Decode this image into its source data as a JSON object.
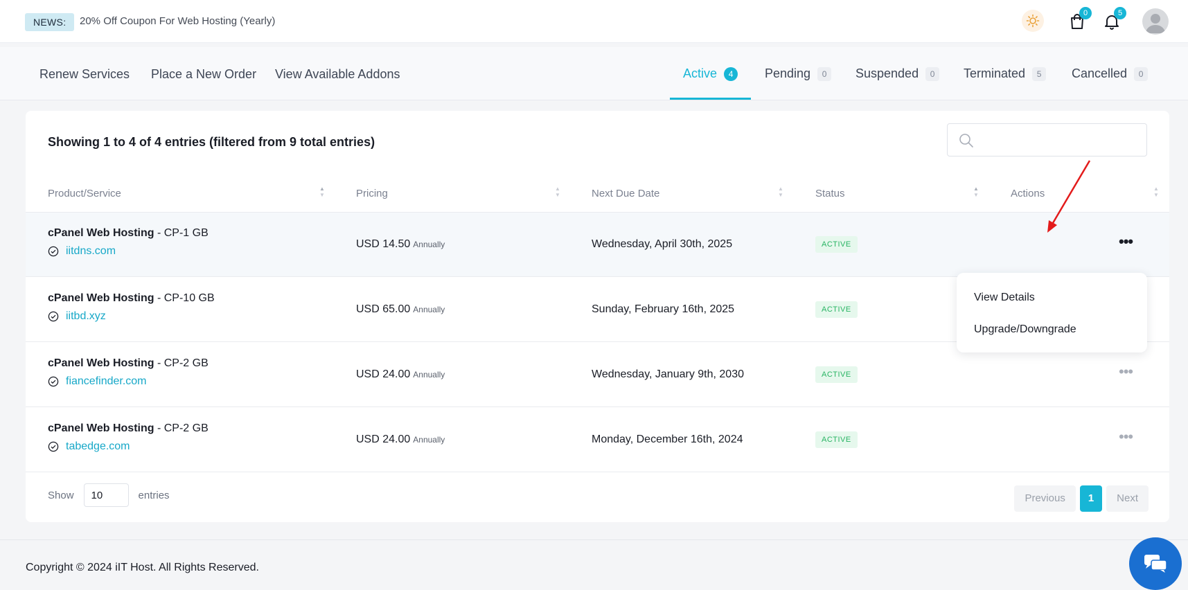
{
  "news": {
    "badge": "NEWS:",
    "text": "20% Off Coupon For Web Hosting (Yearly)"
  },
  "topbar": {
    "cart_count": "0",
    "notification_count": "5",
    "icons": [
      "sun-icon",
      "cart-icon",
      "bell-icon",
      "avatar-icon"
    ]
  },
  "subnav": {
    "links": [
      "Renew Services",
      "Place a New Order",
      "View Available Addons"
    ],
    "tabs": [
      {
        "label": "Active",
        "count": "4",
        "active": true
      },
      {
        "label": "Pending",
        "count": "0",
        "active": false
      },
      {
        "label": "Suspended",
        "count": "0",
        "active": false
      },
      {
        "label": "Terminated",
        "count": "5",
        "active": false
      },
      {
        "label": "Cancelled",
        "count": "0",
        "active": false
      }
    ]
  },
  "table": {
    "showing": "Showing 1 to 4 of 4 entries (filtered from 9 total entries)",
    "search_placeholder": "",
    "columns": [
      "Product/Service",
      "Pricing",
      "Next Due Date",
      "Status",
      "Actions"
    ],
    "rows": [
      {
        "product": "cPanel Web Hosting",
        "plan": " - CP-1 GB",
        "domain": "iitdns.com",
        "price": "USD 14.50",
        "cycle": "Annually",
        "due": "Wednesday, April 30th, 2025",
        "status": "ACTIVE"
      },
      {
        "product": "cPanel Web Hosting",
        "plan": " - CP-10 GB",
        "domain": "iitbd.xyz",
        "price": "USD 65.00",
        "cycle": "Annually",
        "due": "Sunday, February 16th, 2025",
        "status": "ACTIVE"
      },
      {
        "product": "cPanel Web Hosting",
        "plan": " - CP-2 GB",
        "domain": "fiancefinder.com",
        "price": "USD 24.00",
        "cycle": "Annually",
        "due": "Wednesday, January 9th, 2030",
        "status": "ACTIVE"
      },
      {
        "product": "cPanel Web Hosting",
        "plan": " - CP-2 GB",
        "domain": "tabedge.com",
        "price": "USD 24.00",
        "cycle": "Annually",
        "due": "Monday, December 16th, 2024",
        "status": "ACTIVE"
      }
    ],
    "actions_menu": [
      "View Details",
      "Upgrade/Downgrade"
    ],
    "show_label": "Show",
    "entries_label": "entries",
    "page_size": "10",
    "pager": {
      "previous": "Previous",
      "current": "1",
      "next": "Next"
    }
  },
  "footer": {
    "copyright": "Copyright © 2024 iIT Host. All Rights Reserved."
  },
  "colors": {
    "accent": "#17b6d6",
    "active_badge_bg": "#e6f8ed",
    "active_badge_text": "#28b463",
    "chat": "#1a6fd1",
    "arrow": "#e31b1b"
  }
}
